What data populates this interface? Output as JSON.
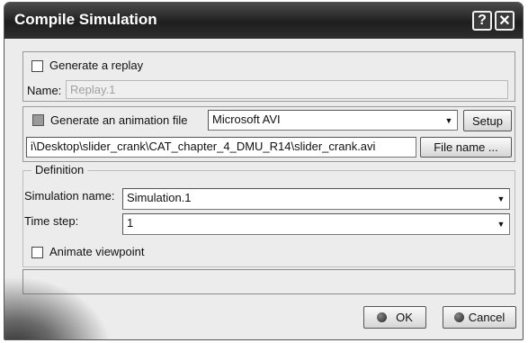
{
  "window": {
    "title": "Compile Simulation"
  },
  "titlebar_buttons": {
    "help": "?",
    "close": "✕"
  },
  "replay": {
    "checkbox_label": "Generate a replay",
    "name_label": "Name:",
    "name_value": "Replay.1"
  },
  "animation": {
    "checkbox_label": "Generate an animation file",
    "format_value": "Microsoft AVI",
    "setup_label": "Setup",
    "path_value": "i\\Desktop\\slider_crank\\CAT_chapter_4_DMU_R14\\slider_crank.avi",
    "file_name_label": "File name ..."
  },
  "definition": {
    "legend": "Definition",
    "simulation_name_label": "Simulation name:",
    "simulation_name_value": "Simulation.1",
    "time_step_label": "Time step:",
    "time_step_value": "1",
    "animate_viewpoint_label": "Animate viewpoint"
  },
  "footer": {
    "ok_label": "OK",
    "cancel_label": "Cancel"
  },
  "icons": {
    "dropdown": "▼"
  }
}
